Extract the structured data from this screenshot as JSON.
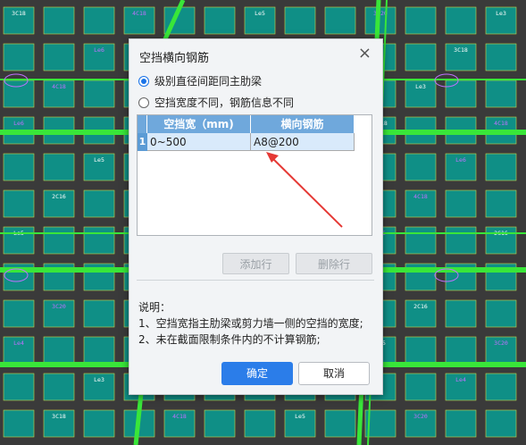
{
  "background": {
    "grid_labels": [
      "3C18",
      "3C20",
      "2C16",
      "4C18",
      "Le3",
      "Le4",
      "Le5",
      "Le6"
    ]
  },
  "dialog": {
    "title": "空挡横向钢筋",
    "close_glyph": "×",
    "radio_options": [
      {
        "label": "级别直径间距同主肋梁",
        "checked": true
      },
      {
        "label": "空挡宽度不同，钢筋信息不同",
        "checked": false
      }
    ],
    "table": {
      "headers": [
        "空挡宽（mm)",
        "横向钢筋"
      ],
      "rows": [
        {
          "index": "1",
          "width": "0~500",
          "rebar": "A8@200"
        }
      ]
    },
    "add_row_label": "添加行",
    "delete_row_label": "删除行",
    "notes": {
      "heading": "说明：",
      "line1": "1、空挡宽指主肋梁或剪力墙一侧的空挡的宽度;",
      "line2": "2、未在截面限制条件内的不计算钢筋;"
    },
    "ok_label": "确定",
    "cancel_label": "取消"
  },
  "colors": {
    "accent": "#2b7de9",
    "arrow": "#e53935",
    "cad_green": "#39e639",
    "cad_teal": "#0f8f86"
  }
}
